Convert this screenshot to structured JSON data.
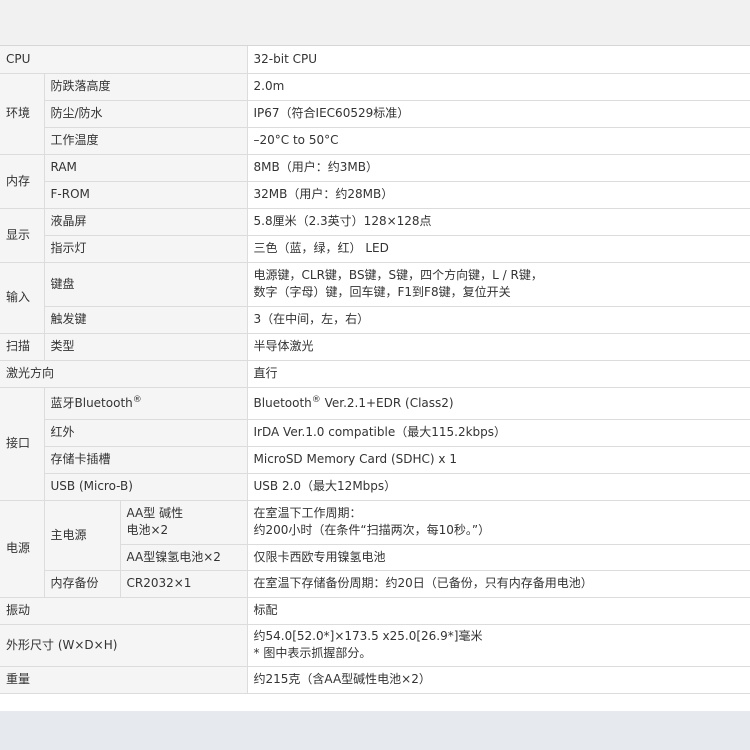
{
  "spec": {
    "cpu": {
      "label": "CPU",
      "value": "32-bit CPU"
    },
    "environment": {
      "label": "环境",
      "drop_height": {
        "label": "防跌落高度",
        "value": "2.0m"
      },
      "dust_water": {
        "label": "防尘/防水",
        "value": "IP67（符合IEC60529标准）"
      },
      "operating_temp": {
        "label": "工作温度",
        "value": "–20°C to 50°C"
      }
    },
    "memory": {
      "label": "内存",
      "ram": {
        "label": "RAM",
        "value": "8MB（用户：约3MB）"
      },
      "from": {
        "label": "F-ROM",
        "value": "32MB（用户：约28MB）"
      }
    },
    "display": {
      "label": "显示",
      "lcd": {
        "label": "液晶屏",
        "value": "5.8厘米（2.3英寸）128×128点"
      },
      "indicator": {
        "label": "指示灯",
        "value": "三色（蓝，绿，红） LED"
      }
    },
    "input": {
      "label": "输入",
      "keyboard": {
        "label": "键盘",
        "value_line1": "电源键，CLR键，BS键，S键，四个方向键，L / R键，",
        "value_line2": "数字（字母）键，回车键，F1到F8键，复位开关"
      },
      "trigger": {
        "label": "触发键",
        "value": "3（在中间，左，右）"
      }
    },
    "scan": {
      "label": "扫描",
      "type": {
        "label": "类型",
        "value": "半导体激光"
      }
    },
    "laser_direction": {
      "label": "激光方向",
      "value": "直行"
    },
    "interface": {
      "label": "接口",
      "bluetooth": {
        "label": "蓝牙Bluetooth",
        "label_mark": "®",
        "value_prefix": "Bluetooth",
        "value_mark": "®",
        "value_suffix": " Ver.2.1+EDR (Class2)"
      },
      "infrared": {
        "label": "红外",
        "value": "IrDA Ver.1.0 compatible（最大115.2kbps）"
      },
      "card_slot": {
        "label": "存储卡插槽",
        "value": "MicroSD Memory Card (SDHC) x 1"
      },
      "usb": {
        "label": "USB (Micro-B)",
        "value": "USB 2.0（最大12Mbps）"
      }
    },
    "power": {
      "label": "电源",
      "main": {
        "label": "主电源",
        "alkaline": {
          "label_line1": "AA型 碱性",
          "label_line2": "电池×2",
          "value_line1": "在室温下工作周期：",
          "value_line2": "约200小时（在条件“扫描两次，每10秒。”）"
        },
        "nimh": {
          "label": "AA型镍氢电池×2",
          "value": "仅限卡西欧专用镍氢电池"
        }
      },
      "backup": {
        "label": "内存备份",
        "sub_label": "CR2032×1",
        "value": "在室温下存储备份周期：约20日（已备份，只有内存备用电池）"
      }
    },
    "vibration": {
      "label": "振动",
      "value": "标配"
    },
    "dimensions": {
      "label": "外形尺寸 (W×D×H)",
      "value_line1": "约54.0[52.0*]×173.5 x25.0[26.9*]毫米",
      "value_line2": "* 图中表示抓握部分。"
    },
    "weight": {
      "label": "重量",
      "value": "约215克（含AA型碱性电池×2）"
    }
  }
}
